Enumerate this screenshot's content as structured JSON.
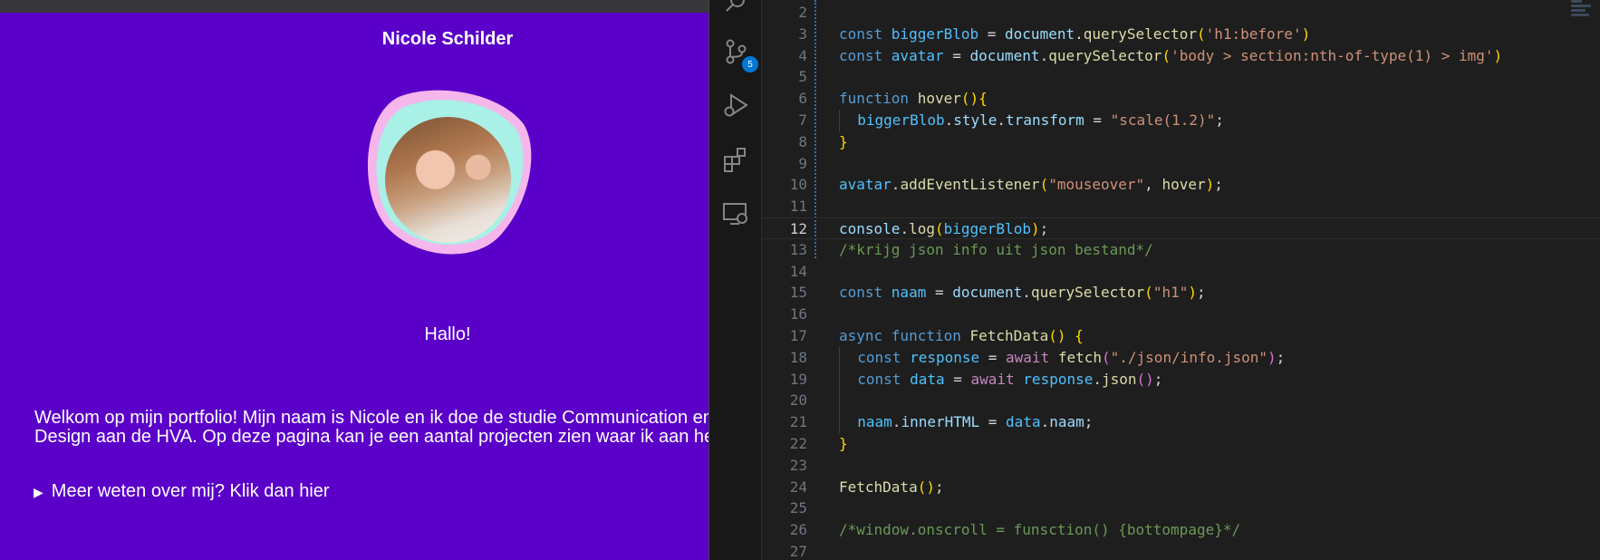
{
  "preview": {
    "title": "Nicole Schilder",
    "greeting": "Hallo!",
    "intro_line1": "Welkom op mijn portfolio! Mijn naam is Nicole en ik doe de studie Communication en",
    "intro_line2": "Design aan de HVA. Op deze pagina kan je een aantal projecten zien waar ik aan he",
    "details_label": "Meer weten over mij? Klik dan hier",
    "colors": {
      "background": "#5a00c9",
      "blob_outer": "#f5b6ec",
      "blob_inner": "#a9f0e6"
    }
  },
  "vscode": {
    "source_control_badge": "5",
    "current_line": 12,
    "colors": {
      "keyword": "#569cd6",
      "control": "#c586c0",
      "variable": "#9cdcfe",
      "constant": "#4fc1ff",
      "function": "#dcdcaa",
      "string": "#ce9178",
      "comment": "#6a9955",
      "punct": "#d4d4d4",
      "bracket1": "#ffd700",
      "bracket2": "#da70d6"
    },
    "lines": [
      {
        "n": "2",
        "indent": 0,
        "tokens": []
      },
      {
        "n": "3",
        "indent": 0,
        "tokens": [
          [
            "keyword",
            "const "
          ],
          [
            "constant",
            "biggerBlob"
          ],
          [
            "punct",
            " = "
          ],
          [
            "variable",
            "document"
          ],
          [
            "punct",
            "."
          ],
          [
            "function",
            "querySelector"
          ],
          [
            "bracket1",
            "("
          ],
          [
            "string",
            "'h1:before'"
          ],
          [
            "bracket1",
            ")"
          ]
        ]
      },
      {
        "n": "4",
        "indent": 0,
        "tokens": [
          [
            "keyword",
            "const "
          ],
          [
            "constant",
            "avatar"
          ],
          [
            "punct",
            " = "
          ],
          [
            "variable",
            "document"
          ],
          [
            "punct",
            "."
          ],
          [
            "function",
            "querySelector"
          ],
          [
            "bracket1",
            "("
          ],
          [
            "string",
            "'body > section:nth-of-type(1) > img'"
          ],
          [
            "bracket1",
            ")"
          ]
        ]
      },
      {
        "n": "5",
        "indent": 0,
        "tokens": []
      },
      {
        "n": "6",
        "indent": 0,
        "tokens": [
          [
            "keyword",
            "function "
          ],
          [
            "function",
            "hover"
          ],
          [
            "bracket1",
            "()"
          ],
          [
            "bracket1",
            "{"
          ]
        ]
      },
      {
        "n": "7",
        "indent": 1,
        "tokens": [
          [
            "constant",
            "biggerBlob"
          ],
          [
            "punct",
            "."
          ],
          [
            "variable",
            "style"
          ],
          [
            "punct",
            "."
          ],
          [
            "variable",
            "transform"
          ],
          [
            "punct",
            " = "
          ],
          [
            "string",
            "\"scale(1.2)\""
          ],
          [
            "punct",
            ";"
          ]
        ]
      },
      {
        "n": "8",
        "indent": 0,
        "tokens": [
          [
            "bracket1",
            "}"
          ]
        ]
      },
      {
        "n": "9",
        "indent": 0,
        "tokens": []
      },
      {
        "n": "10",
        "indent": 0,
        "tokens": [
          [
            "constant",
            "avatar"
          ],
          [
            "punct",
            "."
          ],
          [
            "function",
            "addEventListener"
          ],
          [
            "bracket1",
            "("
          ],
          [
            "string",
            "\"mouseover\""
          ],
          [
            "punct",
            ", "
          ],
          [
            "function",
            "hover"
          ],
          [
            "bracket1",
            ")"
          ],
          [
            "punct",
            ";"
          ]
        ]
      },
      {
        "n": "11",
        "indent": 0,
        "tokens": []
      },
      {
        "n": "12",
        "indent": 0,
        "tokens": [
          [
            "variable",
            "console"
          ],
          [
            "punct",
            "."
          ],
          [
            "function",
            "log"
          ],
          [
            "bracket1",
            "("
          ],
          [
            "constant",
            "biggerBlob"
          ],
          [
            "bracket1",
            ")"
          ],
          [
            "punct",
            ";"
          ]
        ]
      },
      {
        "n": "13",
        "indent": 0,
        "tokens": [
          [
            "comment",
            "/*krijg json info uit json bestand*/"
          ]
        ]
      },
      {
        "n": "14",
        "indent": 0,
        "tokens": []
      },
      {
        "n": "15",
        "indent": 0,
        "tokens": [
          [
            "keyword",
            "const "
          ],
          [
            "constant",
            "naam"
          ],
          [
            "punct",
            " = "
          ],
          [
            "variable",
            "document"
          ],
          [
            "punct",
            "."
          ],
          [
            "function",
            "querySelector"
          ],
          [
            "bracket1",
            "("
          ],
          [
            "string",
            "\"h1\""
          ],
          [
            "bracket1",
            ")"
          ],
          [
            "punct",
            ";"
          ]
        ]
      },
      {
        "n": "16",
        "indent": 0,
        "tokens": []
      },
      {
        "n": "17",
        "indent": 0,
        "tokens": [
          [
            "keyword",
            "async "
          ],
          [
            "keyword",
            "function "
          ],
          [
            "function",
            "FetchData"
          ],
          [
            "bracket1",
            "() {"
          ]
        ]
      },
      {
        "n": "18",
        "indent": 1,
        "tokens": [
          [
            "keyword",
            "const "
          ],
          [
            "constant",
            "response"
          ],
          [
            "punct",
            " = "
          ],
          [
            "control",
            "await "
          ],
          [
            "function",
            "fetch"
          ],
          [
            "bracket2",
            "("
          ],
          [
            "string",
            "\"./json/info.json\""
          ],
          [
            "bracket2",
            ")"
          ],
          [
            "punct",
            ";"
          ]
        ]
      },
      {
        "n": "19",
        "indent": 1,
        "tokens": [
          [
            "keyword",
            "const "
          ],
          [
            "constant",
            "data"
          ],
          [
            "punct",
            " = "
          ],
          [
            "control",
            "await "
          ],
          [
            "constant",
            "response"
          ],
          [
            "punct",
            "."
          ],
          [
            "function",
            "json"
          ],
          [
            "bracket2",
            "()"
          ],
          [
            "punct",
            ";"
          ]
        ]
      },
      {
        "n": "20",
        "indent": 1,
        "tokens": []
      },
      {
        "n": "21",
        "indent": 1,
        "tokens": [
          [
            "constant",
            "naam"
          ],
          [
            "punct",
            "."
          ],
          [
            "variable",
            "innerHTML"
          ],
          [
            "punct",
            " = "
          ],
          [
            "constant",
            "data"
          ],
          [
            "punct",
            "."
          ],
          [
            "variable",
            "naam"
          ],
          [
            "punct",
            ";"
          ]
        ]
      },
      {
        "n": "22",
        "indent": 0,
        "tokens": [
          [
            "bracket1",
            "}"
          ]
        ]
      },
      {
        "n": "23",
        "indent": 0,
        "tokens": []
      },
      {
        "n": "24",
        "indent": 0,
        "tokens": [
          [
            "function",
            "FetchData"
          ],
          [
            "bracket1",
            "()"
          ],
          [
            "punct",
            ";"
          ]
        ]
      },
      {
        "n": "25",
        "indent": 0,
        "tokens": []
      },
      {
        "n": "26",
        "indent": 0,
        "tokens": [
          [
            "comment",
            "/*window.onscroll = funsction() {bottompage}*/"
          ]
        ]
      },
      {
        "n": "27",
        "indent": 0,
        "tokens": []
      }
    ]
  }
}
